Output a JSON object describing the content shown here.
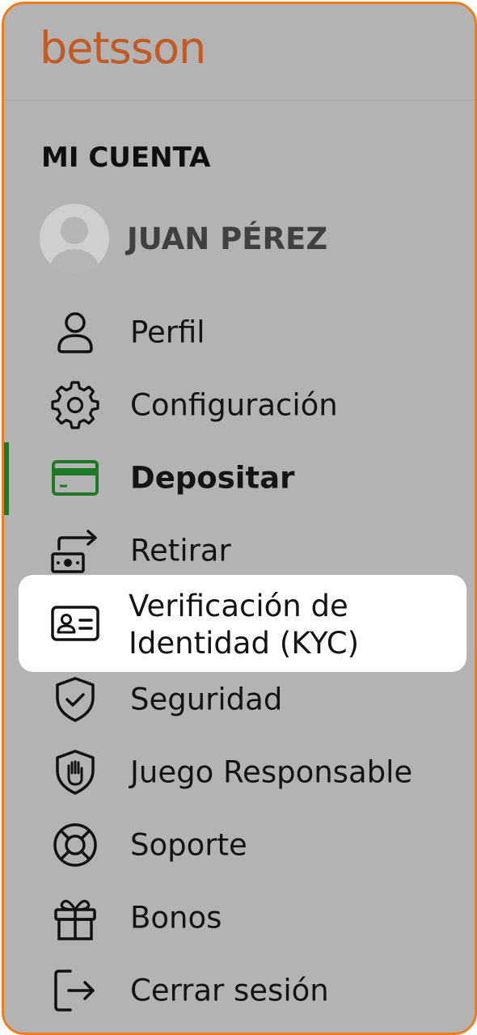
{
  "brand": {
    "logo_text": "betsson",
    "logo_color": "#c25a23"
  },
  "account": {
    "section_title": "MI CUENTA",
    "user_name": "JUAN PÉREZ"
  },
  "menu": {
    "items": [
      {
        "label": "Perfil",
        "icon": "user-icon"
      },
      {
        "label": "Configuración",
        "icon": "gear-icon"
      },
      {
        "label": "Depositar",
        "icon": "credit-card-icon",
        "active": true
      },
      {
        "label": "Retirar",
        "icon": "cash-withdraw-icon"
      },
      {
        "label_line1": "Verificación de",
        "label_line2": "Identidad (KYC)",
        "icon": "id-card-icon",
        "highlighted": true
      },
      {
        "label": "Seguridad",
        "icon": "shield-check-icon"
      },
      {
        "label": "Juego Responsable",
        "icon": "shield-hand-icon"
      },
      {
        "label": "Soporte",
        "icon": "lifebuoy-icon"
      },
      {
        "label": "Bonos",
        "icon": "gift-icon"
      },
      {
        "label": "Cerrar sesión",
        "icon": "logout-icon"
      }
    ]
  },
  "colors": {
    "accent_orange": "#f07c1e",
    "active_green": "#1e7a26",
    "overlay_gray": "#b3b3b3"
  }
}
